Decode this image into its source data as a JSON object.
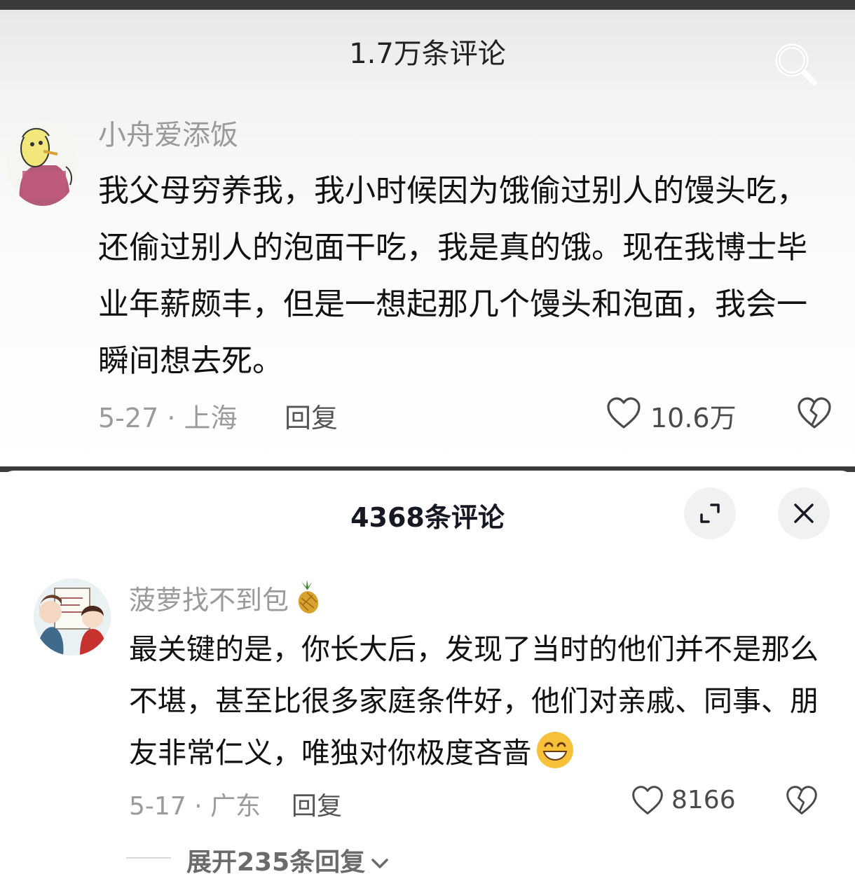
{
  "panel_top": {
    "title": "1.7万条评论",
    "comment": {
      "username": "小舟爱添饭",
      "text": "我父母穷养我，我小时候因为饿偷过别人的馒头吃，还偷过别人的泡面干吃，我是真的饿。现在我博士毕业年薪颇丰，但是一想起那几个馒头和泡面，我会一瞬间想去死。",
      "meta": "5-27 · 上海",
      "reply_label": "回复",
      "like_count": "10.6万"
    }
  },
  "panel_bottom": {
    "title": "4368条评论",
    "comment": {
      "username": "菠萝找不到包",
      "text": "最关键的是，你长大后，发现了当时的他们并不是那么不堪，甚至比很多家庭条件好，他们对亲戚、同事、朋友非常仁义，唯独对你极度吝啬",
      "meta": "5-17 · 广东",
      "reply_label": "回复",
      "like_count": "8166",
      "more_replies": "展开235条回复"
    }
  },
  "colors": {
    "text_primary": "#161823",
    "text_secondary": "#9b9b9b",
    "divider": "#3c3c3c"
  },
  "icons": [
    "search-icon",
    "like-heart-icon",
    "dislike-broken-heart-icon",
    "expand-icon",
    "close-icon",
    "pineapple-emoji",
    "grin-emoji",
    "chevron-down-icon"
  ]
}
